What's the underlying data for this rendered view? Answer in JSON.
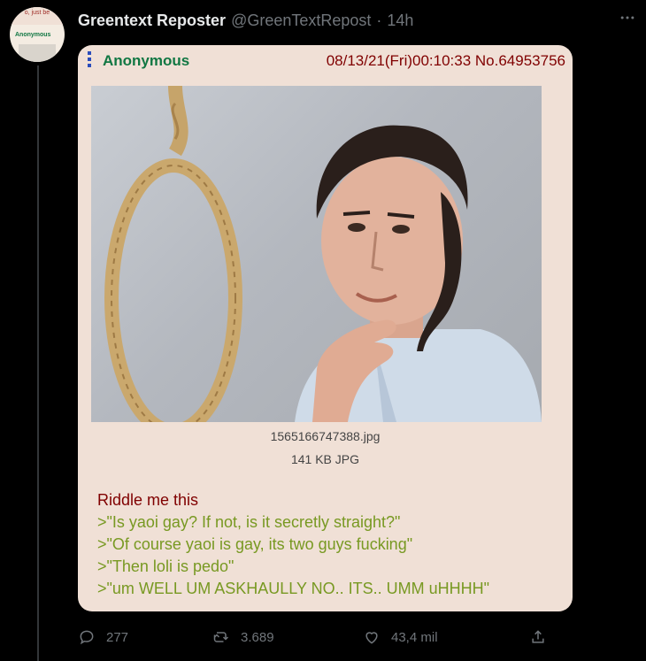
{
  "tweet": {
    "display_name": "Greentext Reposter",
    "handle": "@GreenTextRepost",
    "separator": "·",
    "time": "14h",
    "more_icon": "more-horizontal-icon",
    "avatar": {
      "caption_top": "o, just be",
      "caption_name": "Anonymous"
    }
  },
  "post": {
    "name": "Anonymous",
    "meta": "08/13/21(Fri)00:10:33 No.64953756",
    "file_name": "1565166747388.jpg",
    "file_size": "141 KB JPG",
    "lines": [
      "Riddle me this",
      ">\"Is yaoi gay? If not, is it secretly straight?\"",
      ">\"Of course yaoi is gay, its two guys fucking\"",
      ">\"Then loli is pedo\"",
      ">\"um WELL UM ASKHAULLY NO.. ITS.. UMM uHHHH\""
    ],
    "colors": {
      "background": "#f0e0d6",
      "name": "#117743",
      "meta": "#800000",
      "greentext": "#789922"
    }
  },
  "actions": {
    "reply": {
      "icon": "reply-icon",
      "count": "277"
    },
    "retweet": {
      "icon": "retweet-icon",
      "count": "3.689"
    },
    "like": {
      "icon": "heart-icon",
      "count": "43,4 mil"
    },
    "share": {
      "icon": "share-icon"
    }
  }
}
